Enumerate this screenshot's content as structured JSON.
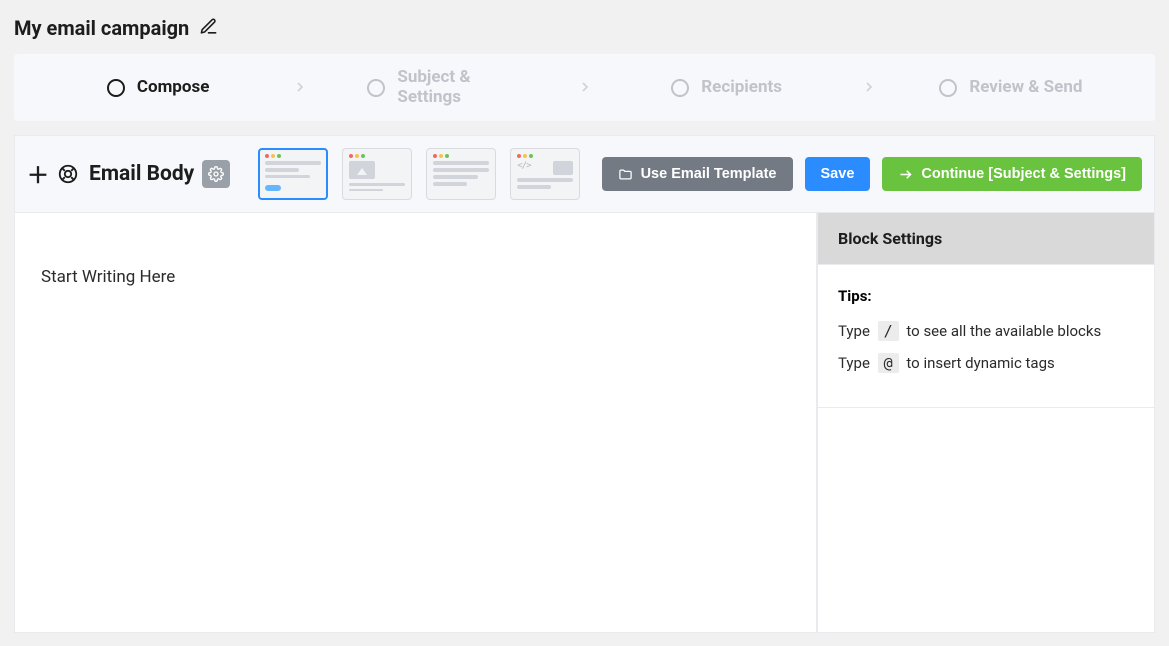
{
  "page_title": "My email campaign",
  "steps": [
    {
      "label": "Compose",
      "active": true
    },
    {
      "label": "Subject & Settings",
      "active": false
    },
    {
      "label": "Recipients",
      "active": false
    },
    {
      "label": "Review & Send",
      "active": false
    }
  ],
  "toolbar": {
    "title": "Email Body",
    "use_template_label": "Use Email Template",
    "save_label": "Save",
    "continue_label": "Continue [Subject & Settings]"
  },
  "layout_thumbs": [
    {
      "name": "layout-thumb-simple",
      "active": true
    },
    {
      "name": "layout-thumb-image-header",
      "active": false
    },
    {
      "name": "layout-thumb-text-only",
      "active": false
    },
    {
      "name": "layout-thumb-code",
      "active": false
    }
  ],
  "editor": {
    "placeholder": "Start Writing Here"
  },
  "sidebar": {
    "heading": "Block Settings",
    "tips_heading": "Tips:",
    "tip1_a": "Type",
    "tip1_key": "/",
    "tip1_b": "to see all the available blocks",
    "tip2_a": "Type",
    "tip2_key": "@",
    "tip2_b": "to insert dynamic tags"
  }
}
